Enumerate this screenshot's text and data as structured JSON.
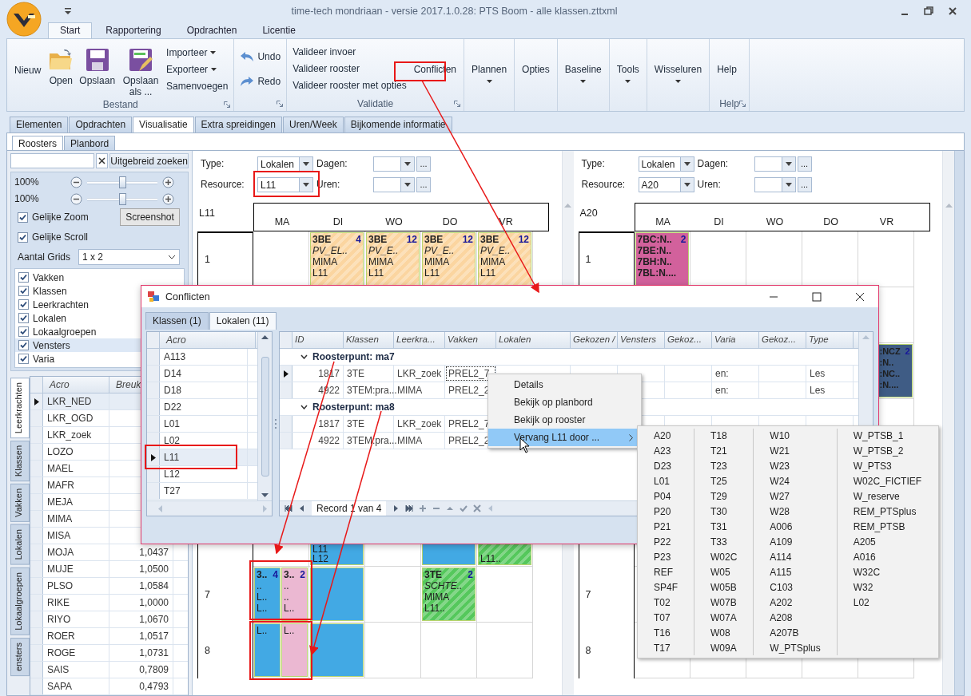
{
  "window": {
    "title": "time-tech mondriaan - versie 2017.1.0.28: PTS Boom - alle klassen.zttxml"
  },
  "ribbon_tabs": [
    {
      "label": "Start",
      "selected": true
    },
    {
      "label": "Rapportering",
      "selected": false
    },
    {
      "label": "Opdrachten",
      "selected": false
    },
    {
      "label": "Licentie",
      "selected": false
    }
  ],
  "ribbon_groups": [
    {
      "label": "Bestand",
      "launcher": true,
      "items": [
        {
          "kind": "plain",
          "label": "Nieuw"
        },
        {
          "kind": "open",
          "label": "Open"
        },
        {
          "kind": "save",
          "label": "Opslaan"
        },
        {
          "kind": "save-as",
          "label": "Opslaan als ..."
        },
        {
          "kind": "stack",
          "entries": [
            {
              "kind": "dropdown",
              "label": "Importeer"
            },
            {
              "kind": "dropdown",
              "label": "Exporteer"
            },
            {
              "kind": "plain",
              "label": "Samenvoegen"
            }
          ]
        }
      ]
    },
    {
      "launcher": true,
      "items": [
        {
          "kind": "stack",
          "entries": [
            {
              "kind": "undo",
              "label": "Undo"
            },
            {
              "kind": "redo",
              "label": "Redo"
            }
          ]
        }
      ]
    },
    {
      "label": "Validatie",
      "launcher": true,
      "items": [
        {
          "kind": "stack",
          "entries": [
            {
              "kind": "plain",
              "label": "Valideer invoer"
            },
            {
              "kind": "plain",
              "label": "Valideer rooster"
            },
            {
              "kind": "plain",
              "label": "Valideer rooster met opties"
            }
          ]
        },
        {
          "kind": "plain",
          "label": "Conflicten"
        }
      ]
    },
    {
      "items": [
        {
          "kind": "menu",
          "label": "Plannen"
        }
      ]
    },
    {
      "items": [
        {
          "kind": "plain",
          "label": "Opties"
        }
      ]
    },
    {
      "items": [
        {
          "kind": "menu",
          "label": "Baseline"
        }
      ]
    },
    {
      "items": [
        {
          "kind": "menu",
          "label": "Tools"
        }
      ]
    },
    {
      "items": [
        {
          "kind": "menu",
          "label": "Wisseluren"
        }
      ]
    },
    {
      "label": "Help",
      "launcher": true,
      "items": [
        {
          "kind": "plain",
          "label": "Help"
        }
      ]
    }
  ],
  "view_tabs": [
    {
      "label": "Elementen",
      "selected": false
    },
    {
      "label": "Opdrachten",
      "selected": false
    },
    {
      "label": "Visualisatie",
      "selected": true
    },
    {
      "label": "Extra spreidingen",
      "selected": false
    },
    {
      "label": "Uren/Week",
      "selected": false
    },
    {
      "label": "Bijkomende informatie",
      "selected": false
    }
  ],
  "sub_tabs": [
    {
      "label": "Roosters",
      "selected": true
    },
    {
      "label": "Planbord",
      "selected": false
    }
  ],
  "side_panel": {
    "advanced_search": "Uitgebreid zoeken",
    "zoom": [
      {
        "reading": "100%",
        "level": 0.5
      },
      {
        "reading": "100%",
        "level": 0.5
      }
    ],
    "options": [
      {
        "label": "Gelijke Zoom",
        "checked": true
      },
      {
        "label": "Gelijke Scroll",
        "checked": true
      }
    ],
    "screenshot": "Screenshot",
    "grids_label": "Aantal Grids",
    "grids_value": "1 x 2",
    "layers": [
      {
        "label": "Vakken",
        "checked": true,
        "selected": false
      },
      {
        "label": "Klassen",
        "checked": true,
        "selected": false
      },
      {
        "label": "Leerkrachten",
        "checked": true,
        "selected": false
      },
      {
        "label": "Lokalen",
        "checked": true,
        "selected": false
      },
      {
        "label": "Lokaalgroepen",
        "checked": true,
        "selected": false
      },
      {
        "label": "Vensters",
        "checked": true,
        "selected": true
      },
      {
        "label": "Varia",
        "checked": true,
        "selected": false
      }
    ],
    "vertical_tabs": [
      {
        "label": "Leerkrachten",
        "selected": true
      },
      {
        "label": "Klassen",
        "selected": false
      },
      {
        "label": "Vakken",
        "selected": false
      },
      {
        "label": "Lokalen",
        "selected": false
      },
      {
        "label": "Lokaalgroepen",
        "selected": false
      },
      {
        "label": "ensters",
        "selected": false
      }
    ],
    "table": {
      "columns": [
        "Acro",
        "Breuk"
      ],
      "rows": [
        {
          "acro": "LKR_NED",
          "selected": true
        },
        {
          "acro": "LKR_OGD",
          "selected": false
        },
        {
          "acro": "LKR_zoek",
          "selected": false
        },
        {
          "acro": "LOZO",
          "selected": false
        },
        {
          "acro": "MAEL",
          "selected": false
        },
        {
          "acro": "MAFR",
          "selected": false
        },
        {
          "acro": "MEJA",
          "selected": false
        },
        {
          "acro": "MIMA",
          "selected": false
        },
        {
          "acro": "MISA",
          "selected": false
        },
        {
          "acro": "MOJA",
          "value": "1,0437",
          "selected": false
        },
        {
          "acro": "MUJE",
          "value": "1,0500",
          "selected": false
        },
        {
          "acro": "PLSO",
          "value": "1,0584",
          "selected": false
        },
        {
          "acro": "RIKE",
          "value": "1,0000",
          "selected": false
        },
        {
          "acro": "RIYO",
          "value": "1,0670",
          "selected": false
        },
        {
          "acro": "ROER",
          "value": "1,0517",
          "selected": false
        },
        {
          "acro": "ROGE",
          "value": "1,0731",
          "selected": false
        },
        {
          "acro": "SAIS",
          "value": "0,7809",
          "selected": false
        },
        {
          "acro": "SAPA",
          "value": "0,4793",
          "selected": false
        }
      ]
    }
  },
  "schedules": [
    {
      "type_label": "Type:",
      "type_value": "Lokalen",
      "days_label": "Dagen:",
      "resource_label": "Resource:",
      "resource_value": "L11",
      "hours_label": "Uren:",
      "more": "...",
      "title": "L11",
      "days": [
        "MA",
        "DI",
        "WO",
        "DO",
        "VR"
      ],
      "rows": [
        {
          "label": "1",
          "cells": [
            {
              "kind": "empty"
            },
            {
              "kind": "filled",
              "blocks": [
                {
                  "kind": "lesson",
                  "color": "#fbd5a0",
                  "hatched": true,
                  "title": "3BE",
                  "count": "4",
                  "lines": [
                    "PV_EL..",
                    "MIMA",
                    "L11"
                  ]
                }
              ]
            },
            {
              "kind": "filled",
              "blocks": [
                {
                  "kind": "lesson",
                  "color": "#fbd5a0",
                  "hatched": true,
                  "title": "3BE",
                  "count": "12",
                  "lines": [
                    "PV_E..",
                    "MIMA",
                    "L11"
                  ]
                }
              ]
            },
            {
              "kind": "filled",
              "blocks": [
                {
                  "kind": "lesson",
                  "color": "#fbd5a0",
                  "hatched": true,
                  "title": "3BE",
                  "count": "12",
                  "lines": [
                    "PV_E..",
                    "MIMA",
                    "L11"
                  ]
                }
              ]
            },
            {
              "kind": "filled",
              "blocks": [
                {
                  "kind": "lesson",
                  "color": "#fbd5a0",
                  "hatched": true,
                  "title": "3BE",
                  "count": "12",
                  "lines": [
                    "PV_E..",
                    "MIMA",
                    "L11"
                  ]
                }
              ]
            }
          ]
        },
        {
          "cells": [
            {
              "kind": "empty"
            },
            {
              "kind": "empty"
            },
            {
              "kind": "empty"
            },
            {
              "kind": "empty"
            },
            {
              "kind": "empty"
            }
          ]
        },
        {
          "cells": [
            {
              "kind": "empty"
            },
            {
              "kind": "empty"
            },
            {
              "kind": "empty"
            },
            {
              "kind": "empty"
            },
            {
              "kind": "empty"
            }
          ]
        },
        {
          "cells": [
            {
              "kind": "empty"
            },
            {
              "kind": "empty"
            },
            {
              "kind": "empty"
            },
            {
              "kind": "empty"
            },
            {
              "kind": "empty"
            }
          ]
        },
        {
          "cells": [
            {
              "kind": "empty"
            },
            {
              "kind": "empty"
            },
            {
              "kind": "empty"
            },
            {
              "kind": "empty"
            },
            {
              "kind": "empty"
            }
          ]
        },
        {
          "cells": [
            {
              "kind": "empty"
            },
            {
              "kind": "filled",
              "blocks": [
                {
                  "kind": "tail",
                  "color": "#42a9e4",
                  "hatched": false,
                  "lines": [
                    "L11",
                    "L12"
                  ]
                }
              ]
            },
            {
              "kind": "empty"
            },
            {
              "kind": "filled",
              "blocks": [
                {
                  "kind": "fill",
                  "color": "#42a9e4",
                  "hatched": false
                }
              ]
            },
            {
              "kind": "filled",
              "blocks": [
                {
                  "kind": "tail",
                  "color": "#55c85c",
                  "hatched": true,
                  "lines": [
                    "L11.."
                  ]
                }
              ]
            }
          ]
        },
        {
          "label": "7",
          "cells": [
            {
              "kind": "filled",
              "blocks": [
                {
                  "kind": "short",
                  "color": "#42a9e4",
                  "hatched": false,
                  "title": "3..",
                  "count": "4",
                  "lines": [
                    "..",
                    "L..",
                    "L.."
                  ]
                },
                {
                  "kind": "short",
                  "color": "#ebb8d2",
                  "hatched": false,
                  "title": "3..",
                  "count": "2",
                  "lines": [
                    "..",
                    "..",
                    "L.."
                  ]
                }
              ]
            },
            {
              "kind": "filled",
              "blocks": [
                {
                  "kind": "fill",
                  "color": "#42a9e4",
                  "hatched": false
                }
              ]
            },
            {
              "kind": "empty"
            },
            {
              "kind": "filled",
              "blocks": [
                {
                  "kind": "lesson",
                  "color": "#55c85c",
                  "hatched": true,
                  "title": "3TE",
                  "count": "2",
                  "lines": [
                    "SCHTE..",
                    "MIMA",
                    "L11.."
                  ]
                }
              ]
            },
            {
              "kind": "empty"
            }
          ]
        },
        {
          "label": "8",
          "cells": [
            {
              "kind": "filled",
              "blocks": [
                {
                  "kind": "cont",
                  "color": "#42a9e4",
                  "hatched": false,
                  "lines": [
                    "L.."
                  ]
                },
                {
                  "kind": "cont",
                  "color": "#ebb8d2",
                  "hatched": false,
                  "lines": [
                    "L.."
                  ]
                }
              ]
            },
            {
              "kind": "filled",
              "blocks": [
                {
                  "kind": "fill",
                  "color": "#42a9e4",
                  "hatched": false
                }
              ]
            },
            {
              "kind": "empty"
            },
            {
              "kind": "empty"
            },
            {
              "kind": "empty"
            }
          ]
        }
      ]
    },
    {
      "type_label": "Type:",
      "type_value": "Lokalen",
      "days_label": "Dagen:",
      "resource_label": "Resource:",
      "resource_value": "A20",
      "hours_label": "Uren:",
      "more": "...",
      "title": "A20",
      "days": [
        "MA",
        "DI",
        "WO",
        "DO",
        "VR"
      ],
      "rows": [
        {
          "label": "1",
          "cells": [
            {
              "kind": "filled",
              "blocks": [
                {
                  "kind": "groups",
                  "color": "#d2619c",
                  "hatched": false,
                  "title": "7BC:N..",
                  "count": "2",
                  "lines": [
                    "7BE:N..",
                    "7BH:N..",
                    "7BL:N...."
                  ]
                }
              ]
            },
            {
              "kind": "empty"
            },
            {
              "kind": "empty"
            },
            {
              "kind": "empty"
            },
            {
              "kind": "empty"
            }
          ]
        },
        {
          "cells": [
            {
              "kind": "empty"
            },
            {
              "kind": "empty"
            },
            {
              "kind": "empty"
            },
            {
              "kind": "empty"
            },
            {
              "kind": "empty"
            }
          ]
        },
        {
          "cells": [
            {
              "kind": "empty"
            },
            {
              "kind": "empty"
            },
            {
              "kind": "empty"
            },
            {
              "kind": "empty"
            },
            {
              "kind": "filled",
              "blocks": [
                {
                  "kind": "edge",
                  "color": "#3f5c85",
                  "hatched": false,
                  "title": ":NCZ",
                  "count": "2",
                  "lines": [
                    ":N..",
                    ":NC..",
                    ":N...."
                  ]
                }
              ]
            }
          ]
        },
        {
          "cells": [
            {
              "kind": "empty"
            },
            {
              "kind": "empty"
            },
            {
              "kind": "empty"
            },
            {
              "kind": "empty"
            },
            {
              "kind": "empty"
            }
          ]
        },
        {
          "cells": [
            {
              "kind": "empty"
            },
            {
              "kind": "empty"
            },
            {
              "kind": "empty"
            },
            {
              "kind": "empty"
            },
            {
              "kind": "empty"
            }
          ]
        },
        {
          "cells": [
            {
              "kind": "empty"
            },
            {
              "kind": "empty"
            },
            {
              "kind": "empty"
            },
            {
              "kind": "empty"
            },
            {
              "kind": "empty"
            }
          ]
        },
        {
          "label": "7",
          "cells": [
            {
              "kind": "empty"
            },
            {
              "kind": "empty"
            },
            {
              "kind": "empty"
            },
            {
              "kind": "empty"
            },
            {
              "kind": "empty"
            }
          ]
        },
        {
          "label": "8",
          "cells": [
            {
              "kind": "empty"
            },
            {
              "kind": "empty"
            },
            {
              "kind": "empty"
            },
            {
              "kind": "empty"
            },
            {
              "kind": "empty"
            }
          ]
        }
      ]
    }
  ],
  "dialog": {
    "title": "Conflicten",
    "tabs": [
      {
        "label": "Klassen (1)",
        "selected": false
      },
      {
        "label": "Lokalen (11)",
        "selected": true
      }
    ],
    "resources": {
      "column": "Acro",
      "rows": [
        {
          "label": "A113",
          "selected": false
        },
        {
          "label": "D14",
          "selected": false
        },
        {
          "label": "D18",
          "selected": false
        },
        {
          "label": "D22",
          "selected": false
        },
        {
          "label": "L01",
          "selected": false
        },
        {
          "label": "L02",
          "selected": false
        },
        {
          "label": "L11",
          "selected": true
        },
        {
          "label": "L12",
          "selected": false
        },
        {
          "label": "T27",
          "selected": false
        }
      ]
    },
    "conflicts": {
      "columns": [
        "ID",
        "Klassen",
        "Leerkra...",
        "Vakken",
        "Lokalen",
        "Gekozen /",
        "Vensters",
        "Gekoz...",
        "Varia",
        "Gekoz...",
        "Type"
      ],
      "groups": [
        {
          "label": "Roosterpunt: ma7",
          "expanded": true,
          "rows": [
            {
              "selected": true,
              "id": "1817",
              "klassen": "3TE",
              "leerkrachten": "LKR_zoek",
              "vakken": "PREL2_7",
              "varia": "en:",
              "type": "Les"
            },
            {
              "selected": false,
              "id": "4922",
              "klassen": "3TEM:pra...",
              "leerkrachten": "MIMA",
              "vakken": "PREL2_2",
              "varia": "en:",
              "type": "Les"
            }
          ]
        },
        {
          "label": "Roosterpunt: ma8",
          "expanded": true,
          "rows": [
            {
              "selected": false,
              "id": "1817",
              "klassen": "3TE",
              "leerkrachten": "LKR_zoek",
              "vakken": "PREL2_7"
            },
            {
              "selected": false,
              "id": "4922",
              "klassen": "3TEM:pra...",
              "leerkrachten": "MIMA",
              "vakken": "PREL2_2"
            }
          ]
        }
      ],
      "record": "Record 1 van 4"
    }
  },
  "context_menu": [
    {
      "label": "Details",
      "selected": false,
      "submenu": false
    },
    {
      "label": "Bekijk op planbord",
      "selected": false,
      "submenu": false
    },
    {
      "label": "Bekijk op rooster",
      "selected": false,
      "submenu": false
    },
    {
      "label": "Vervang L11 door ...",
      "selected": true,
      "submenu": true
    }
  ],
  "submenu": [
    [
      "A20",
      "A23",
      "D23",
      "L01",
      "P04",
      "P20",
      "P21",
      "P22",
      "P23",
      "REF",
      "SP4F",
      "T02",
      "T07",
      "T16",
      "T17"
    ],
    [
      "T18",
      "T21",
      "T23",
      "T25",
      "T29",
      "T30",
      "T31",
      "T33",
      "W02C",
      "W05",
      "W05B",
      "W07B",
      "W07A",
      "W08",
      "W09A"
    ],
    [
      "W10",
      "W21",
      "W23",
      "W24",
      "W27",
      "W28",
      "A006",
      "A109",
      "A114",
      "A115",
      "C103",
      "A202",
      "A208",
      "A207B",
      "W_PTSplus"
    ],
    [
      "W_PTSB_1",
      "W_PTSB_2",
      "W_PTS3",
      "W02C_FICTIEF",
      "W_reserve",
      "REM_PTSplus",
      "REM_PTSB",
      "A205",
      "A016",
      "W32C",
      "W32",
      "L02"
    ]
  ]
}
